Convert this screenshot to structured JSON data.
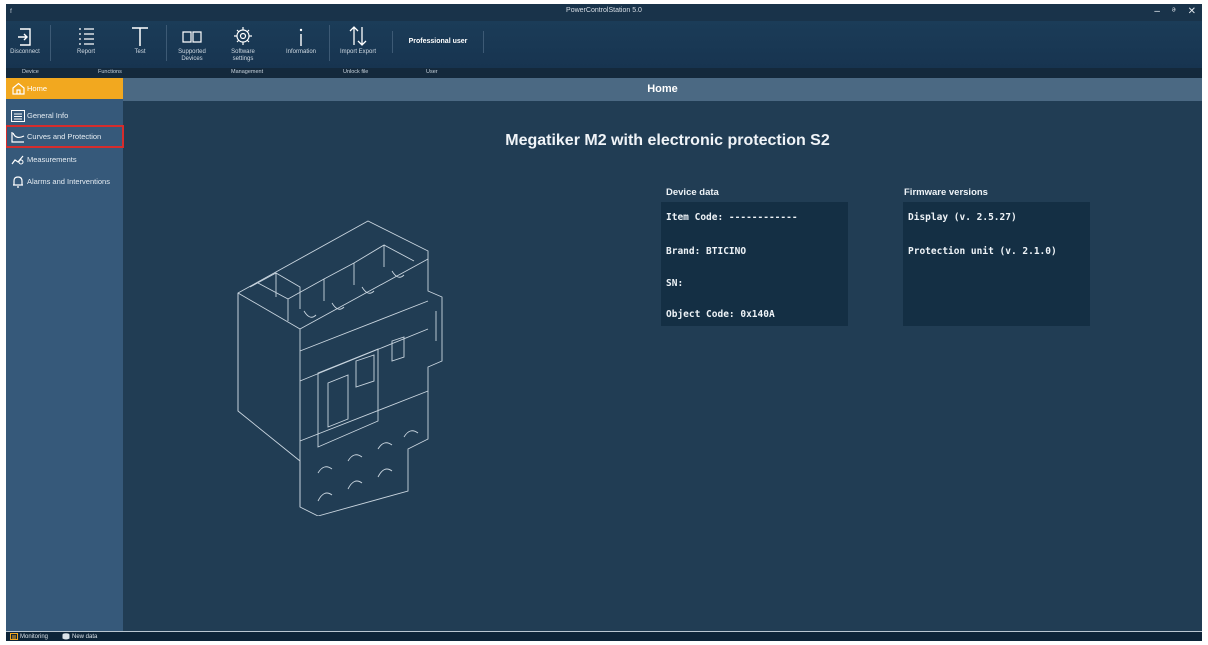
{
  "window": {
    "title": "PowerControlStation 5.0",
    "minimize": "–",
    "restore": "ᵊ",
    "close": "✕"
  },
  "ribbon": {
    "disconnect": "Disconnect",
    "report": "Report",
    "test": "Test",
    "supported_devices": "Supported Devices",
    "software_settings": "Software settings",
    "information": "Information",
    "import_export": "Import Export",
    "professional_user": "Professional user",
    "groups": {
      "device": "Device",
      "functions": "Functions",
      "management": "Management",
      "unlock_file": "Unlock file",
      "user": "User"
    }
  },
  "sidebar": {
    "items": [
      {
        "label": "Home",
        "icon": "home-icon"
      },
      {
        "label": "General Info",
        "icon": "list-icon"
      },
      {
        "label": "Curves and Protection",
        "icon": "curve-icon"
      },
      {
        "label": "Measurements",
        "icon": "measure-icon"
      },
      {
        "label": "Alarms and Interventions",
        "icon": "bell-icon"
      }
    ]
  },
  "main": {
    "header": "Home",
    "device_title": "Megatiker M2 with electronic protection S2",
    "device_data": {
      "heading": "Device data",
      "item_code": "Item Code: ------------",
      "brand": "Brand: BTICINO",
      "sn": "SN:",
      "object_code": "Object Code: 0x140A"
    },
    "firmware": {
      "heading": "Firmware versions",
      "display": "Display (v. 2.5.27)",
      "protection": "Protection unit (v. 2.1.0)"
    }
  },
  "statusbar": {
    "monitoring": "Monitoring",
    "new_data": "New data"
  },
  "colors": {
    "accent": "#f2a81f",
    "highlight": "#d62c2c",
    "background": "#213d54",
    "sidebar": "#36597a"
  }
}
